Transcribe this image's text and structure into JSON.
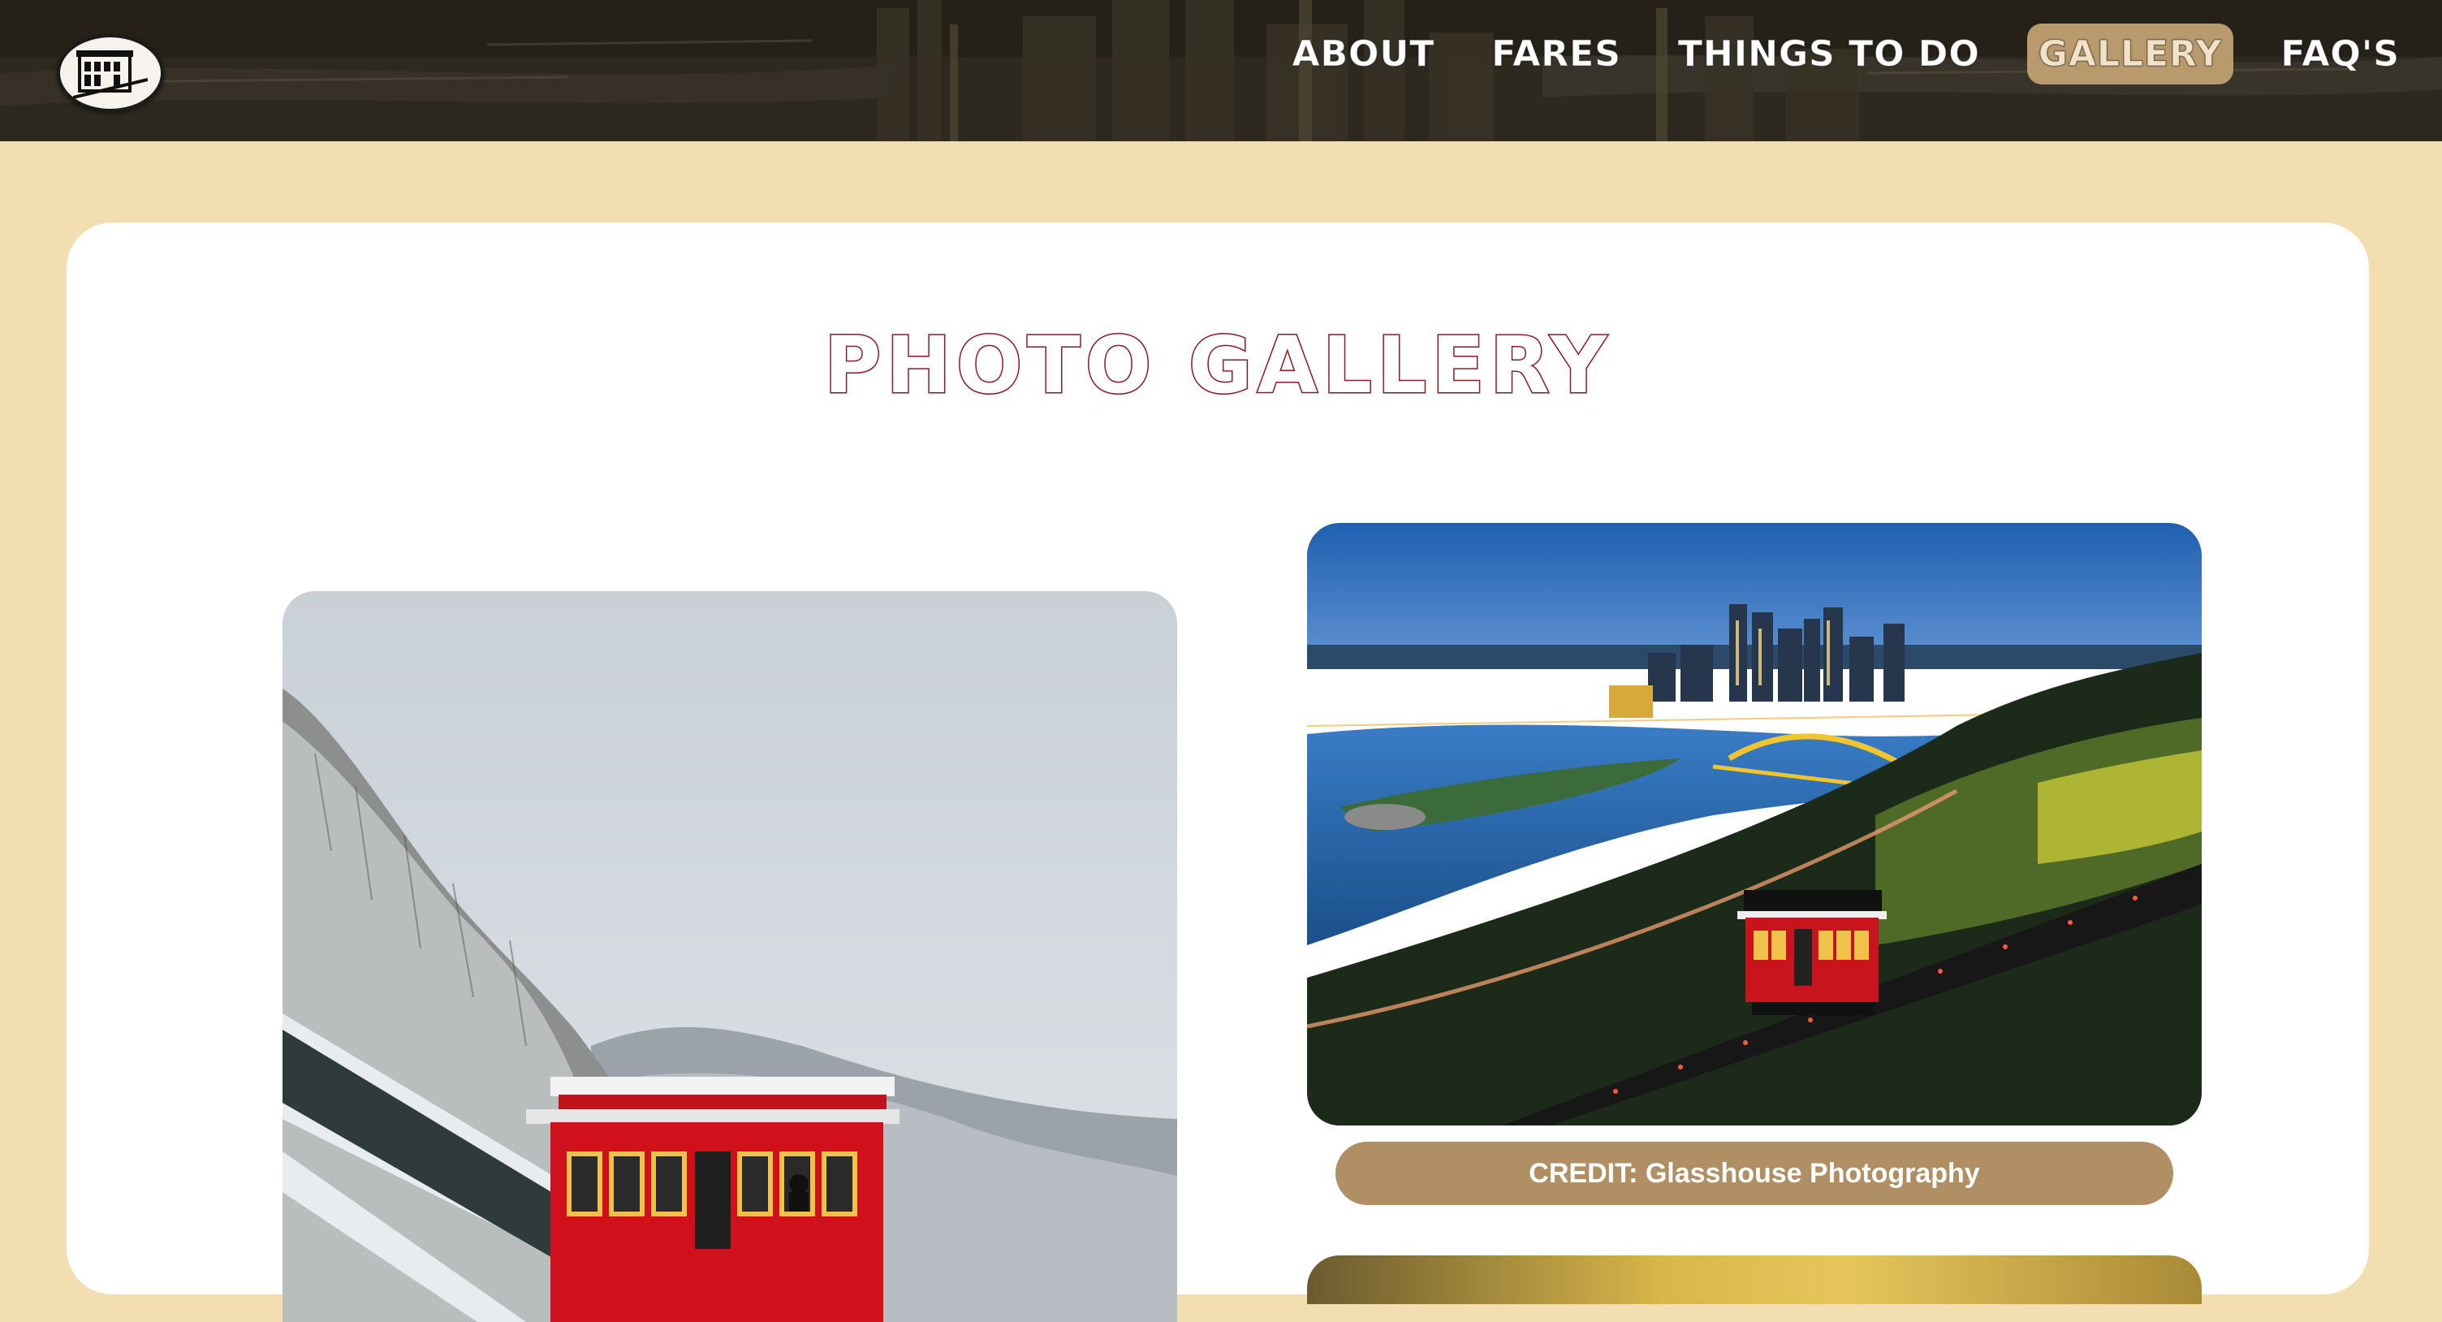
{
  "header": {
    "logo_label": "logo",
    "nav": [
      {
        "label": "ABOUT",
        "active": false
      },
      {
        "label": "FARES",
        "active": false
      },
      {
        "label": "THINGS TO DO",
        "active": false
      },
      {
        "label": "GALLERY",
        "active": true
      },
      {
        "label": "FAQ'S",
        "active": false
      }
    ]
  },
  "main": {
    "title": "PHOTO GALLERY",
    "photos": [
      {
        "subject": "red incline car descending snowy hillside"
      },
      {
        "subject": "Pittsburgh skyline at dusk with incline car",
        "credit": "CREDIT: Glasshouse Photography"
      }
    ]
  },
  "colors": {
    "page_bg": "#f2deb0",
    "title_stroke": "#8a1a23",
    "active_nav_bg": "#b89a6d",
    "credit_bg": "#b08f64"
  }
}
